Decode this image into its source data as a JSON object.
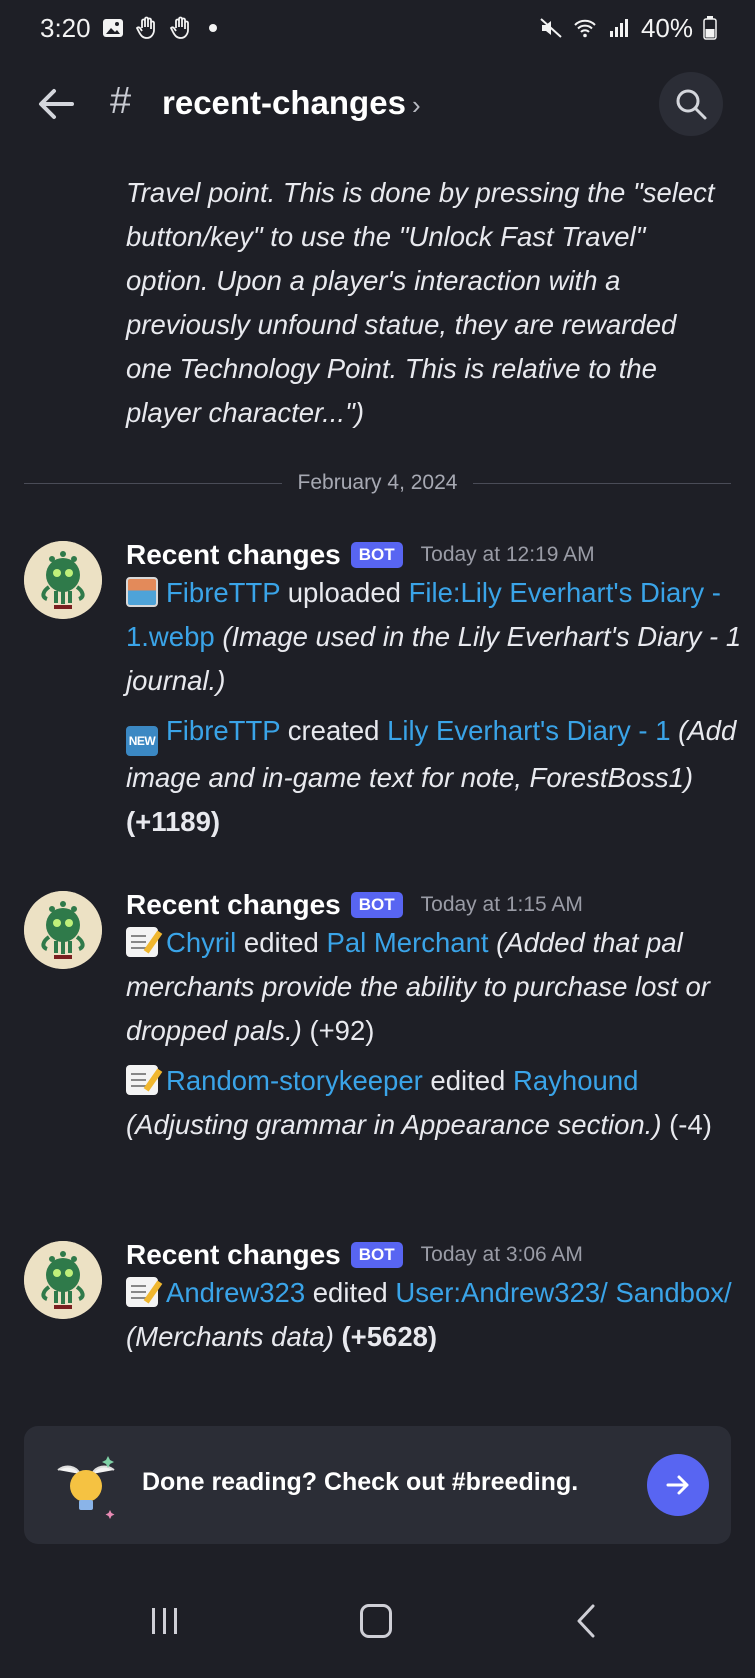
{
  "status_bar": {
    "time": "3:20",
    "battery": "40%"
  },
  "header": {
    "hash": "#",
    "channel": "recent-changes",
    "chevron": "›"
  },
  "previous_message": {
    "text": "Travel point. This is done by pressing the \"select button/key\" to use the \"Unlock Fast Travel\" option. Upon a player's interaction with a previously unfound statue, they are rewarded one Technology Point. This is relative to the player character...\")"
  },
  "date_divider": "February 4, 2024",
  "messages": [
    {
      "author": "Recent changes",
      "badge": "BOT",
      "time": "Today at 12:19 AM",
      "entries": [
        {
          "emoji": "frame-photo-icon",
          "user": "FibreTTP",
          "action": "uploaded",
          "target": "File:Lily Everhart's Diary - 1.webp",
          "summary": "(Image used in the Lily Everhart's Diary - 1 journal.)",
          "delta": ""
        },
        {
          "emoji": "new-button-icon",
          "emoji_text": "NEW",
          "user": "FibreTTP",
          "action": "created",
          "target": "Lily Everhart's Diary - 1",
          "summary": "(Add image and in-game text for note, ForestBoss1)",
          "delta": "(+1189)"
        }
      ]
    },
    {
      "author": "Recent changes",
      "badge": "BOT",
      "time": "Today at 1:15 AM",
      "entries": [
        {
          "emoji": "memo-icon",
          "user": "Chyril",
          "action": "edited",
          "target": "Pal Merchant",
          "summary": "(Added that pal merchants provide the ability to purchase lost or dropped pals.)",
          "delta": "(+92)"
        },
        {
          "emoji": "memo-icon",
          "user": "Random-storykeeper",
          "action": "edited",
          "target": "Rayhound",
          "summary": "(Adjusting grammar in Appearance section.)",
          "delta": "(-4)"
        }
      ]
    },
    {
      "author": "Recent changes",
      "badge": "BOT",
      "time": "Today at 3:06 AM",
      "entries": [
        {
          "emoji": "memo-icon",
          "user": "Andrew323",
          "action": "edited",
          "target": "User:Andrew323/ Sandbox/",
          "summary": "(Merchants data)",
          "delta": "(+5628)"
        }
      ]
    }
  ],
  "cta": {
    "text": "Done reading? Check out #breeding."
  },
  "colors": {
    "background": "#1e1f26",
    "link": "#3aa4e8",
    "blurple": "#5865f2"
  }
}
